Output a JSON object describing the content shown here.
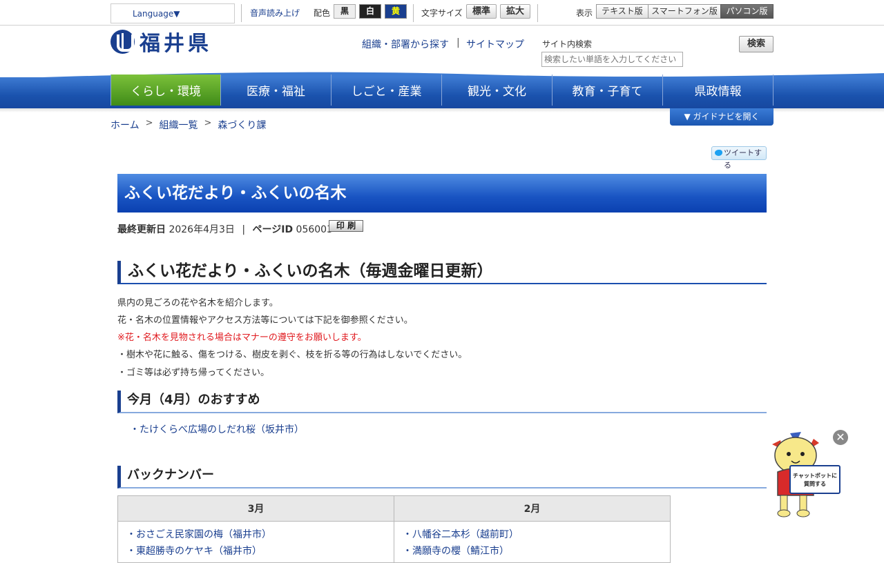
{
  "utility": {
    "language": "Language▼",
    "voice": "音声読み上げ",
    "color_label": "配色",
    "color_black": "黒",
    "color_white": "白",
    "color_yellow": "黄",
    "fontsize_label": "文字サイズ",
    "fontsize_normal": "標準",
    "fontsize_large": "拡大",
    "display_label": "表示",
    "display_text": "テキスト版",
    "display_smartphone": "スマートフォン版",
    "display_pc": "パソコン版"
  },
  "header": {
    "logo_text": "福井県",
    "link_org": "組織・部署から探す",
    "separator": "|",
    "link_sitemap": "サイトマップ",
    "search_label": "サイト内検索",
    "search_placeholder": "検索したい単語を入力してください",
    "search_button": "検索"
  },
  "nav": {
    "items": [
      {
        "label": "くらし・環境"
      },
      {
        "label": "医療・福祉"
      },
      {
        "label": "しごと・産業"
      },
      {
        "label": "観光・文化"
      },
      {
        "label": "教育・子育て"
      },
      {
        "label": "県政情報"
      }
    ],
    "active_index": 0
  },
  "breadcrumb": {
    "items": [
      "ホーム",
      "組織一覧",
      "森づくり課"
    ],
    "separator": ">"
  },
  "guide_button": "▼ ガイドナビを開く",
  "tweet": "ツイートする",
  "page": {
    "title": "ふくい花だより・ふくいの名木",
    "updated_label": "最終更新日",
    "updated_value": "2026年4月3日",
    "meta_sep": "|",
    "id_label": "ページID",
    "id_value": "056003",
    "print": "印 刷"
  },
  "content": {
    "heading": "ふくい花だより・ふくいの名木（毎週金曜日更新）",
    "paragraphs": [
      "県内の見ごろの花や名木を紹介します。",
      "花・名木の位置情報やアクセス方法等については下記を御参照ください。",
      "※花・名木を見物される場合はマナーの遵守をお願いします。",
      "・樹木や花に触る、傷をつける、樹皮を剥ぐ、枝を折る等の行為はしないでください。",
      "・ゴミ等は必ず持ち帰ってください。"
    ],
    "recommend_heading": "今月（4月）のおすすめ",
    "recommend_link": "・たけくらべ広場のしだれ桜（坂井市）",
    "backnumber_heading": "バックナンバー",
    "backnumber": {
      "headers": [
        "3月",
        "2月"
      ],
      "col1": [
        "・おさごえ民家園の梅（福井市）",
        "・東超勝寺のケヤキ（福井市）"
      ],
      "col2": [
        "・八幡谷二本杉（越前町）",
        "・満願寺の櫻（鯖江市）"
      ]
    }
  },
  "chatbot": {
    "close": "✕",
    "sign_line1": "チャットボットに",
    "sign_line2": "質問する"
  },
  "colors": {
    "brand": "#1a3f8f",
    "nav_active": "#5aa327",
    "nav": "#1a52ad",
    "warning": "#e0191e"
  }
}
